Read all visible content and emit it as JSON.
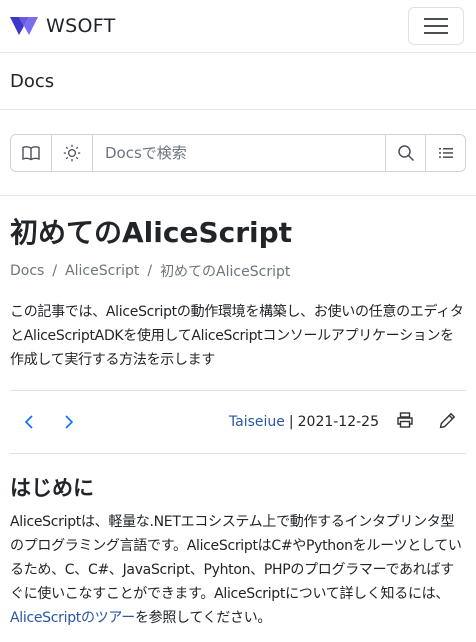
{
  "brand": {
    "name": "WSOFT",
    "accent": "#5b4fd8"
  },
  "header": {
    "title": "Docs"
  },
  "search": {
    "placeholder": "Docsで検索"
  },
  "icons": {
    "book": "book-icon",
    "theme": "sun-icon",
    "search": "search-icon",
    "toc": "list-icon",
    "prev": "chevron-left-icon",
    "next": "chevron-right-icon",
    "print": "printer-icon",
    "edit": "pencil-icon",
    "menu": "hamburger-icon"
  },
  "article": {
    "title": "初めてのAliceScript",
    "breadcrumb": [
      "Docs",
      "AliceScript",
      "初めてのAliceScript"
    ],
    "summary": "この記事では、AliceScriptの動作環境を構築し、お使いの任意のエディタとAliceScriptADKを使用してAliceScriptコンソールアプリケーションを作成して実行する方法を示します",
    "author": "Taiseiue",
    "separator": "|",
    "date": "2021-12-25",
    "section_title": "はじめに",
    "body_text": "AliceScriptは、軽量な.NETエコシステム上で動作するインタプリンタ型のプログラミング言語です。AliceScriptはC#やPythonをルーツとしているため、C、C#、JavaScript、Pyhton、PHPのプログラマーであればすぐに使いこなすことができます。AliceScriptについて詳しく知るには、",
    "body_link": "AliceScriptのツアー",
    "body_tail": "を参照してください。"
  },
  "colors": {
    "link": "#2a56a8",
    "pager": "#0d6efd",
    "border": "#dee2e6"
  }
}
